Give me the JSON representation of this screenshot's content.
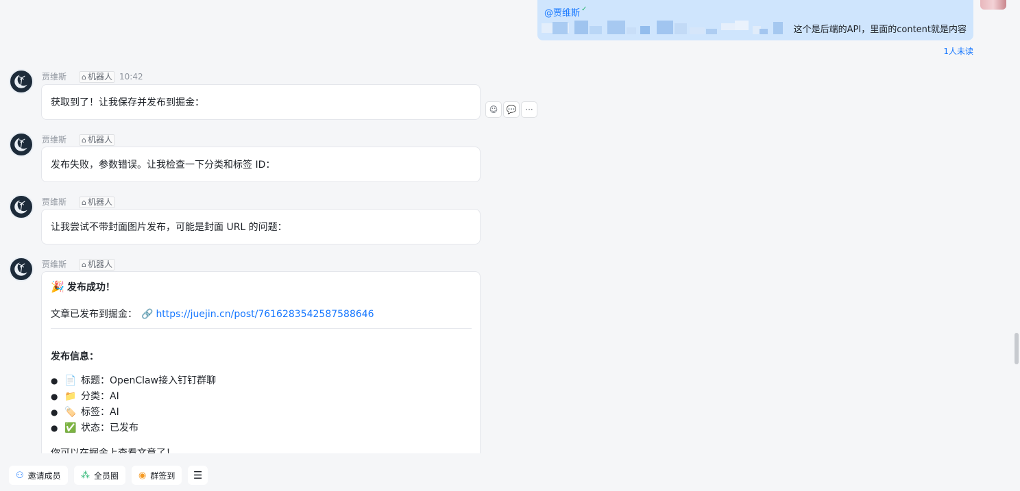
{
  "outgoing": {
    "mention": "@贾维斯",
    "text": "这个是后端的API，里面的content就是内容",
    "read_status": "1人未读"
  },
  "messages": [
    {
      "sender": "贾维斯",
      "tag": "机器人",
      "time": "10:42",
      "text": "获取到了！让我保存并发布到掘金："
    },
    {
      "sender": "贾维斯",
      "tag": "机器人",
      "time": "",
      "text": "发布失败，参数错误。让我检查一下分类和标签 ID："
    },
    {
      "sender": "贾维斯",
      "tag": "机器人",
      "time": "",
      "text": "让我尝试不带封面图片发布，可能是封面 URL 的问题："
    },
    {
      "sender": "贾维斯",
      "tag": "机器人",
      "time": ""
    }
  ],
  "success": {
    "emoji": "🎉",
    "title": "发布成功！",
    "published_label": "文章已发布到掘金：",
    "link_emoji": "🔗",
    "link": "https://juejin.cn/post/7616283542587588646",
    "info_heading": "发布信息：",
    "items": [
      {
        "emoji": "📄",
        "text": "标题：OpenClaw接入钉钉群聊"
      },
      {
        "emoji": "📁",
        "text": "分类：AI"
      },
      {
        "emoji": "🏷️",
        "text": "标签：AI"
      },
      {
        "emoji": "✅",
        "text": "状态：已发布"
      }
    ],
    "footer": "你可以在掘金上查看文章了！"
  },
  "toolbar": {
    "invite": "邀请成员",
    "circle": "全员圈",
    "checkin": "群签到"
  },
  "colors": {
    "outgoing_bubble": "#cfe5fd",
    "link": "#1677ff",
    "background": "#f5f6f8"
  }
}
